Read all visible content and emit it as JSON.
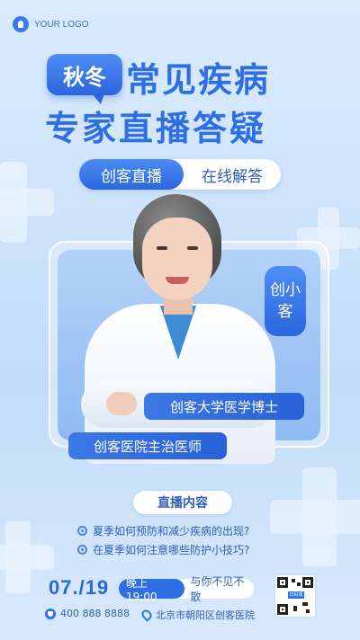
{
  "logo": {
    "text": "YOUR LOGO"
  },
  "hero": {
    "badge": "秋冬",
    "title_line1": "常见疾病",
    "title_line2": "专家直播答疑"
  },
  "tags": {
    "primary": "创客直播",
    "secondary": "在线解答"
  },
  "doctor": {
    "name": "创小客",
    "title1": "创客大学医学博士",
    "title2": "创客医院主治医师"
  },
  "content": {
    "heading": "直播内容",
    "items": [
      "夏季如何预防和减少疾病的出现?",
      "在夏季如何注意哪些防护小技巧?"
    ]
  },
  "footer": {
    "date": "07./19",
    "time": "晚上19:00",
    "time_note": "与你不见不散",
    "phone": "400 888 8888",
    "address": "北京市朝阳区创客医院",
    "qr_label": "扫码观看"
  },
  "colors": {
    "accent": "#2f6fe4",
    "background": "#cfe4fb"
  }
}
